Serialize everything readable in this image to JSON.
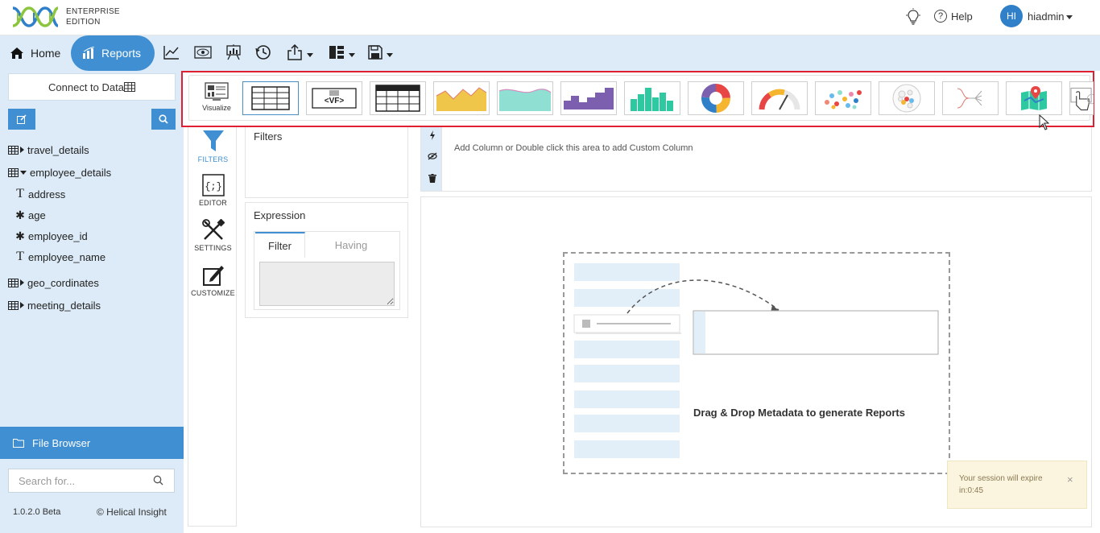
{
  "brand": {
    "edition_line1": "ENTERPRISE",
    "edition_line2": "EDITION"
  },
  "header": {
    "help_label": "Help",
    "avatar_initials": "HI",
    "username": "hiadmin"
  },
  "nav": {
    "home_label": "Home",
    "reports_label": "Reports"
  },
  "toolbar_icons": [
    "line-chart-icon",
    "eye-icon",
    "presentation-icon",
    "history-icon",
    "share-icon",
    "layout-icon",
    "save-icon"
  ],
  "sidebar": {
    "connect_label": "Connect to Data",
    "tree": [
      {
        "label": "travel_details",
        "expanded": false
      },
      {
        "label": "employee_details",
        "expanded": true,
        "children": [
          {
            "label": "address",
            "type": "text"
          },
          {
            "label": "age",
            "type": "number"
          },
          {
            "label": "employee_id",
            "type": "number"
          },
          {
            "label": "employee_name",
            "type": "text"
          }
        ]
      },
      {
        "label": "geo_cordinates",
        "expanded": false
      },
      {
        "label": "meeting_details",
        "expanded": false
      }
    ],
    "file_browser_label": "File Browser",
    "search_placeholder": "Search for...",
    "version": "1.0.2.0 Beta",
    "copyright": "© Helical Insight"
  },
  "visualize": {
    "label": "Visualize",
    "chart_types": [
      "table",
      "vf",
      "grid",
      "area",
      "stacked-area",
      "bar",
      "histogram",
      "pie",
      "gauge",
      "scatter",
      "bubble",
      "tree",
      "map",
      "custom"
    ]
  },
  "side_tools": {
    "filters": "FILTERS",
    "editor": "EDITOR",
    "settings": "SETTINGS",
    "customize": "CUSTOMIZE"
  },
  "filters_panel": {
    "title": "Filters"
  },
  "expression_panel": {
    "title": "Expression",
    "tab_filter": "Filter",
    "tab_having": "Having"
  },
  "columns": {
    "hint": "Add Column or Double click this area to add Custom Column"
  },
  "canvas": {
    "dnd_text": "Drag & Drop Metadata to generate Reports"
  },
  "toast": {
    "message": "Your session will expire in:0:45",
    "close": "×"
  },
  "colors": {
    "accent": "#3f8fd2",
    "nav_bg": "#dcebf7",
    "highlight_frame": "#e02030"
  }
}
